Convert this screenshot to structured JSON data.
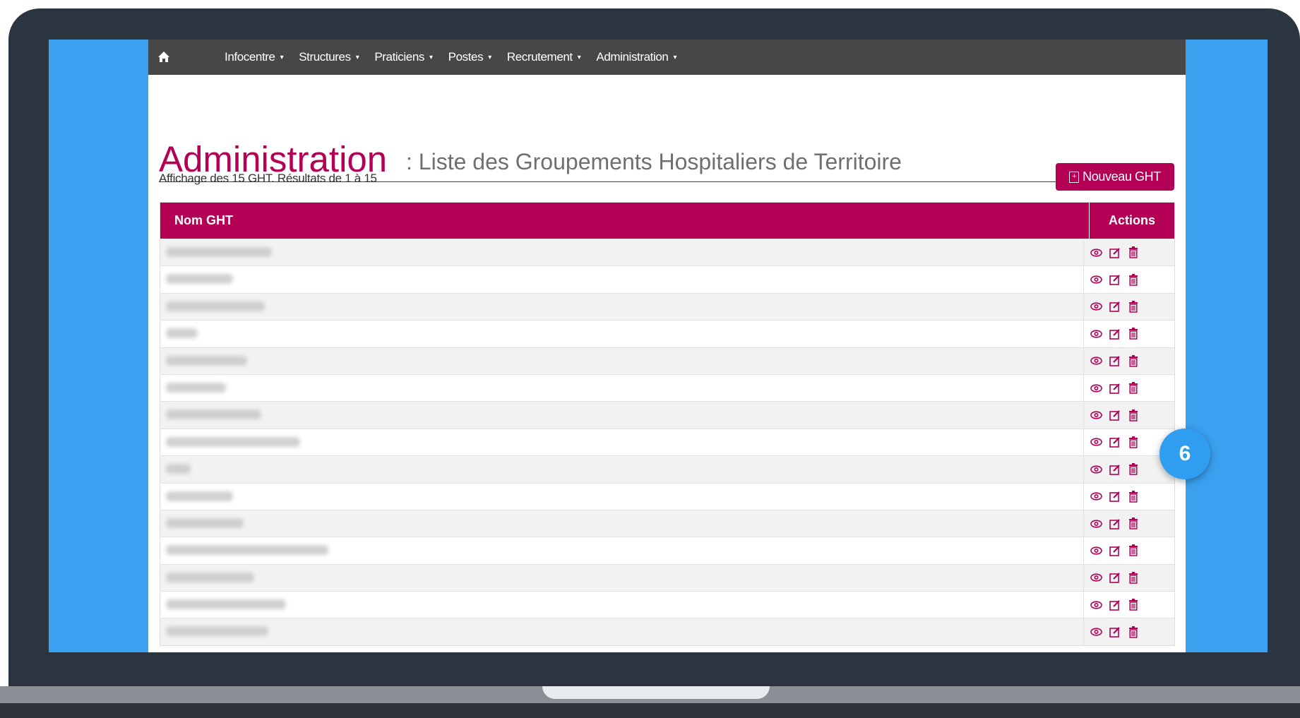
{
  "navbar": {
    "home_icon": "home-icon",
    "items": [
      {
        "label": "Infocentre"
      },
      {
        "label": "Structures"
      },
      {
        "label": "Praticiens"
      },
      {
        "label": "Postes"
      },
      {
        "label": "Recrutement"
      },
      {
        "label": "Administration"
      }
    ]
  },
  "page": {
    "title": "Administration",
    "subtitle": ": Liste des Groupements Hospitaliers de Territoire",
    "summary": "Affichage des 15 GHT. Résultats de 1 à 15",
    "new_button_label": "Nouveau GHT"
  },
  "table": {
    "columns": [
      "Nom GHT",
      "Actions"
    ],
    "row_count": 15
  },
  "badge": {
    "label": "6"
  },
  "colors": {
    "brand": "#b30055",
    "navbar": "#474747",
    "screen_background": "#3aa0f0",
    "badge": "#2f9ef0"
  }
}
